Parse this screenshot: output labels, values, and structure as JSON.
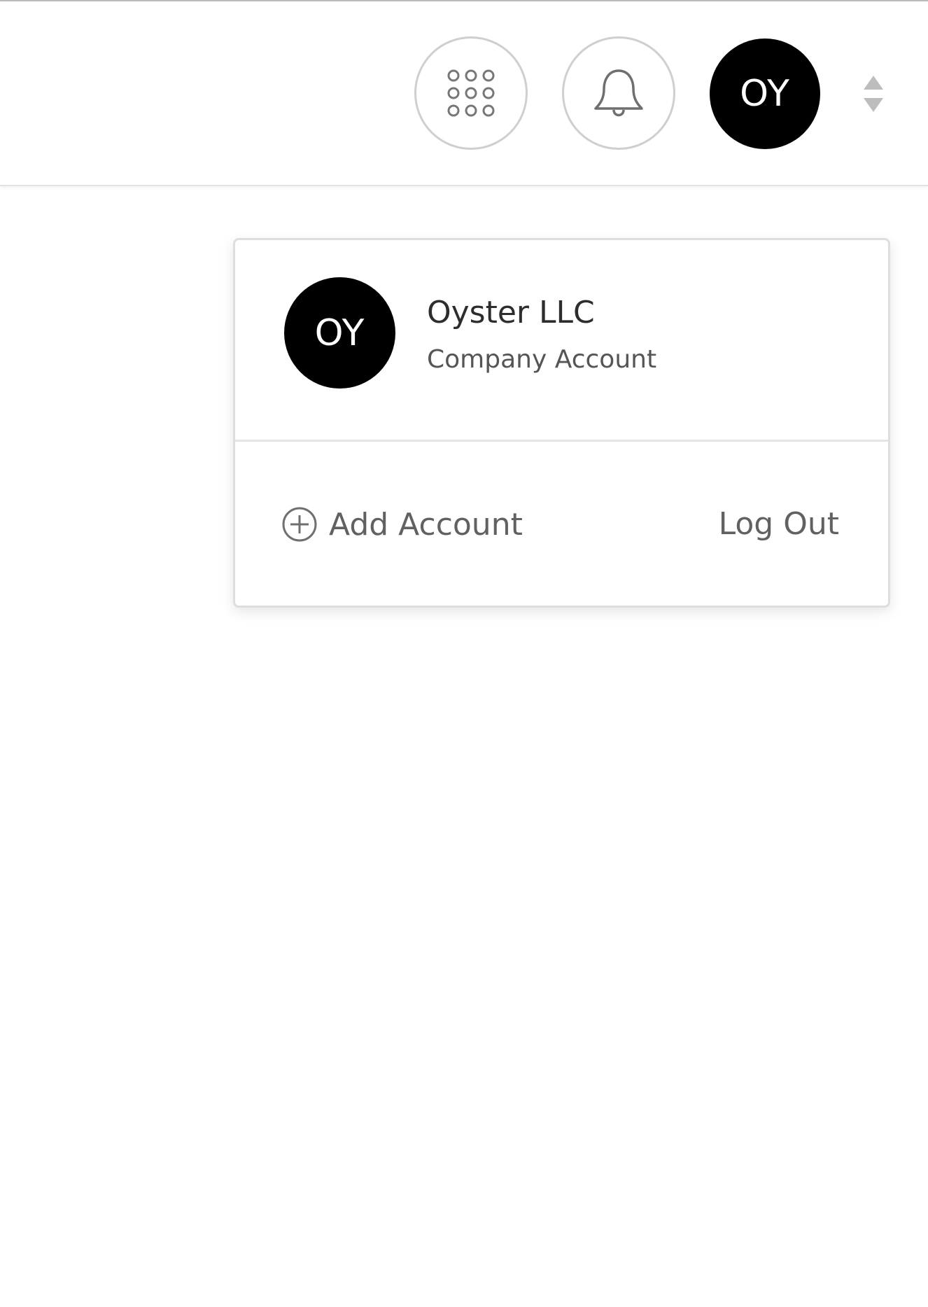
{
  "header": {
    "apps_icon": "apps-grid-icon",
    "notifications_icon": "bell-icon",
    "avatar_initials": "OY",
    "sort_icon": "sort-arrows-icon"
  },
  "dropdown": {
    "account": {
      "initials": "OY",
      "name": "Oyster LLC",
      "type": "Company Account"
    },
    "add_account_label": "Add Account",
    "add_account_icon": "plus-circle-icon",
    "logout_label": "Log Out"
  },
  "colors": {
    "avatar_bg": "#000000",
    "border": "#cfcfcf",
    "muted_text": "#616161"
  }
}
